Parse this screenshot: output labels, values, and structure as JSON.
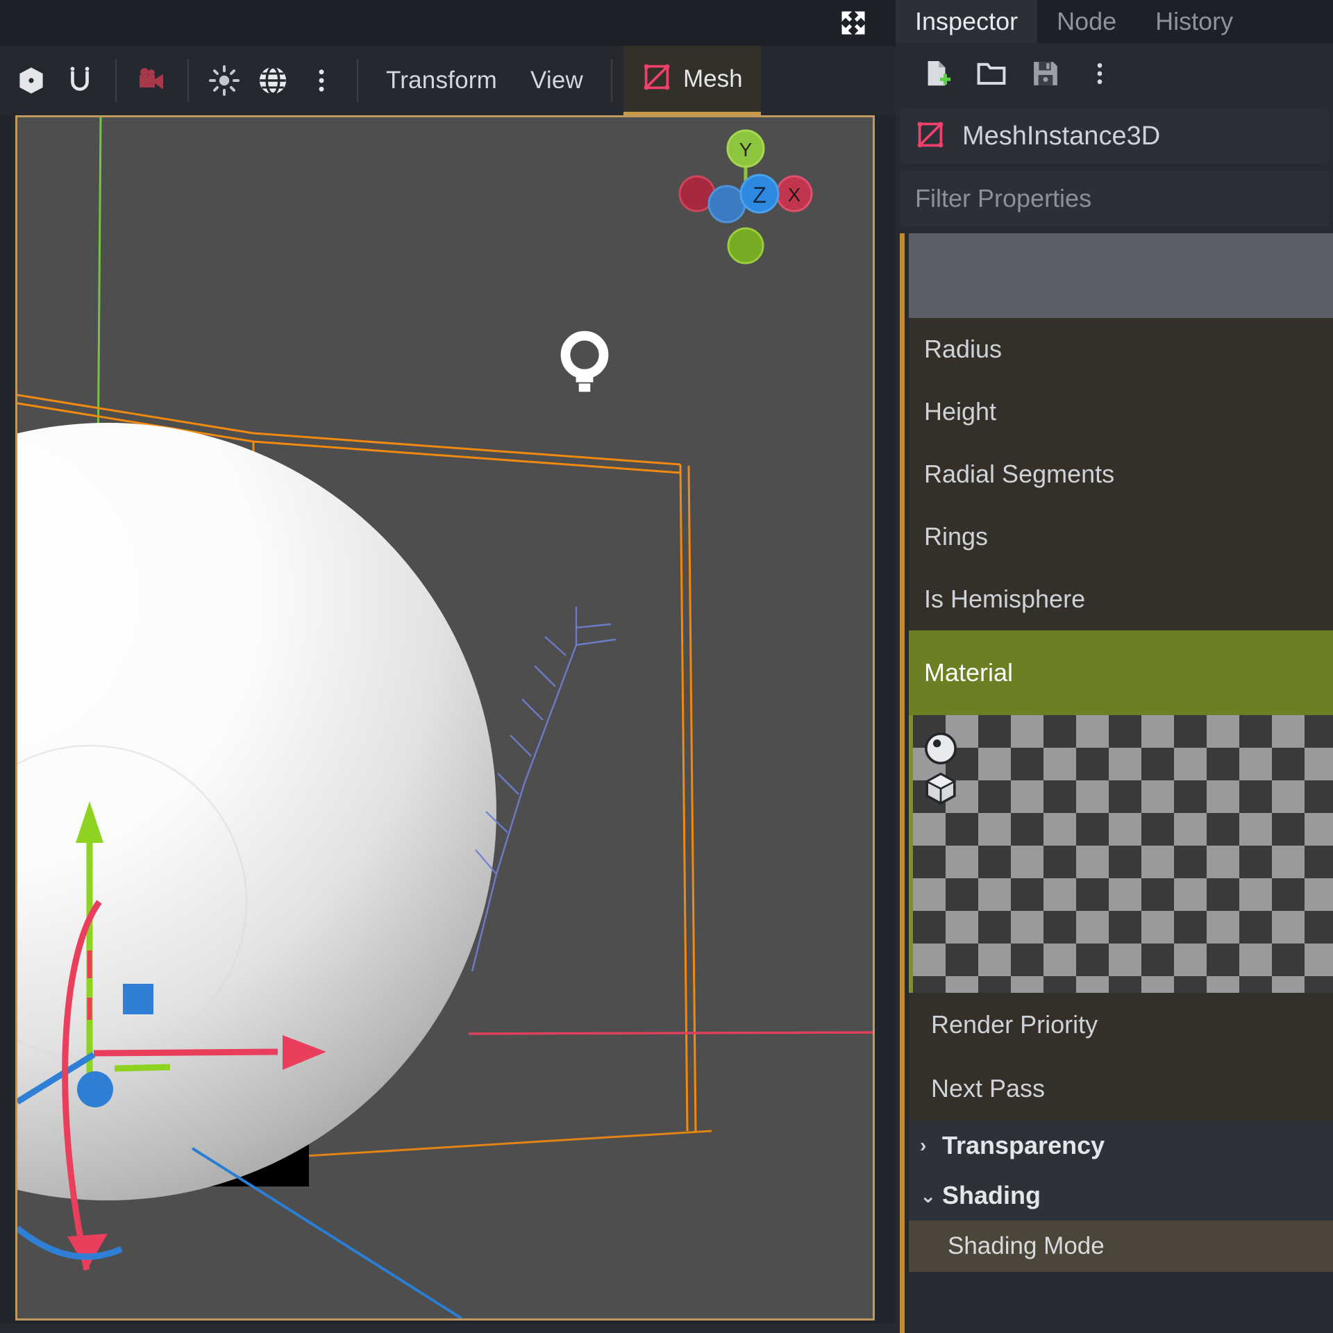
{
  "viewport_toolbar": {
    "icons": [
      {
        "name": "local-space-icon",
        "label": "Local Space"
      },
      {
        "name": "snap-magnet-icon",
        "label": "Use Snap"
      },
      {
        "name": "camera-preview-icon",
        "label": "Preview Camera"
      },
      {
        "name": "sun-preview-icon",
        "label": "Preview Sun"
      },
      {
        "name": "environment-globe-icon",
        "label": "Preview Environment"
      },
      {
        "name": "kebab-menu-icon",
        "label": "More Options"
      }
    ],
    "menus": [
      "Transform",
      "View"
    ],
    "mesh_tab": "Mesh",
    "fullscreen_label": "Toggle Fullscreen"
  },
  "viewport": {
    "gizmo": {
      "axis_y": "Y",
      "axis_x": "X",
      "axis_z": "Z"
    },
    "light_gizmo": "omni-light-icon"
  },
  "dock": {
    "tabs": [
      {
        "label": "Inspector",
        "active": true
      },
      {
        "label": "Node",
        "active": false
      },
      {
        "label": "History",
        "active": false
      }
    ],
    "toolbar_icons": [
      {
        "name": "new-resource-icon",
        "label": "New Resource"
      },
      {
        "name": "open-folder-icon",
        "label": "Load Resource"
      },
      {
        "name": "save-disk-icon",
        "label": "Save Resource"
      },
      {
        "name": "kebab-menu-icon",
        "label": "Extra Options"
      }
    ],
    "node": {
      "icon": "mesh-instance-3d-icon",
      "name": "MeshInstance3D"
    },
    "filter": {
      "placeholder": "Filter Properties",
      "value": ""
    }
  },
  "properties": {
    "blank_row": "",
    "rows": [
      {
        "label": "Radius"
      },
      {
        "label": "Height"
      },
      {
        "label": "Radial Segments"
      },
      {
        "label": "Rings"
      },
      {
        "label": "Is Hemisphere"
      }
    ],
    "material_section": {
      "label": "Material",
      "accent_color": "#6d7f23"
    },
    "material_preview": {
      "shape_buttons": [
        {
          "name": "preview-sphere-icon",
          "label": "Sphere Preview"
        },
        {
          "name": "preview-cube-icon",
          "label": "Box Preview"
        }
      ]
    },
    "after_preview": [
      {
        "label": "Render Priority"
      },
      {
        "label": "Next Pass"
      }
    ],
    "categories": [
      {
        "label": "Transparency",
        "expanded": false,
        "arrow": "›"
      },
      {
        "label": "Shading",
        "expanded": true,
        "arrow": "⌄"
      }
    ],
    "sub_rows": [
      {
        "label": "Shading Mode"
      }
    ]
  },
  "colors": {
    "accent_orange": "#c19a5b",
    "property_accent": "#c18a37",
    "section_green": "#6d7f23",
    "viewport_bg": "#4e4e4e",
    "panel_bg": "#262a31",
    "mesh_red": "#f1416a"
  }
}
